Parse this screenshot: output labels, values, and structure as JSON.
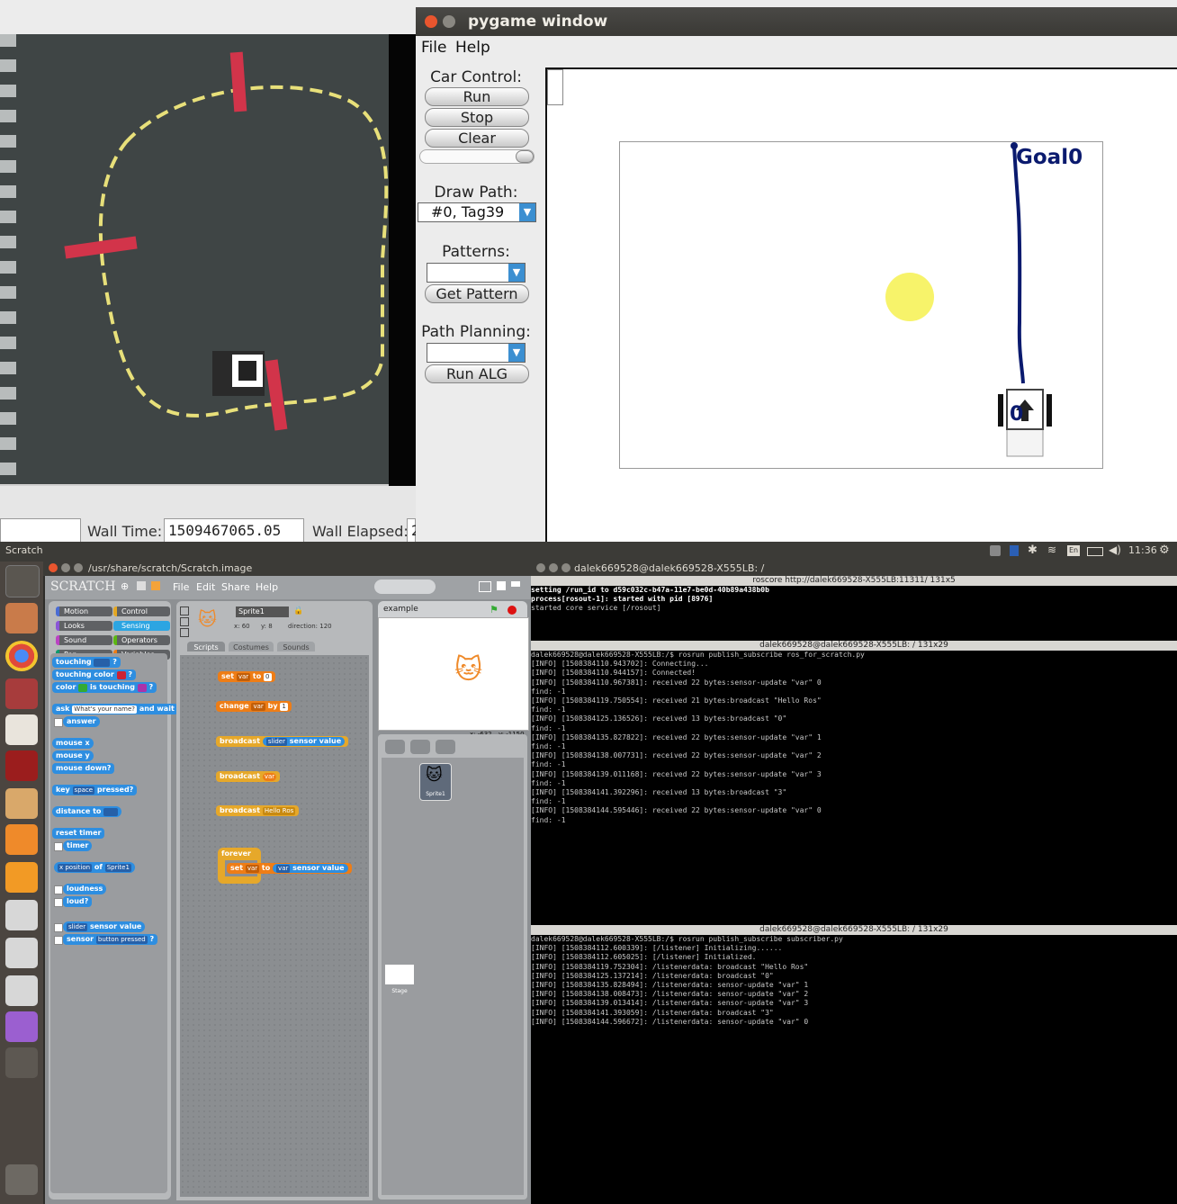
{
  "camera": {
    "status_left": "",
    "wall_time_label": "Wall Time:",
    "wall_time_value": "1509467065.05",
    "wall_elapsed_label": "Wall Elapsed:",
    "wall_elapsed_value": "2"
  },
  "pygame": {
    "title": "pygame window",
    "menu": [
      "File",
      "Help"
    ],
    "car_control_label": "Car Control:",
    "buttons": {
      "run": "Run",
      "stop": "Stop",
      "clear": "Clear",
      "get_pattern": "Get Pattern",
      "run_alg": "Run ALG"
    },
    "draw_path_label": "Draw Path:",
    "draw_path_value": "#0, Tag39",
    "patterns_label": "Patterns:",
    "patterns_value": "",
    "path_planning_label": "Path Planning:",
    "path_planning_value": "",
    "goal_label": "Goal0",
    "car_label": "0",
    "colors": {
      "path": "#0a1a6e",
      "goal": "#0a1a6e",
      "sun": "#f7f36a"
    }
  },
  "panel": {
    "title": "Scratch",
    "time": "11:36",
    "lang": "En"
  },
  "scratch": {
    "window_title": "/usr/share/scratch/Scratch.image",
    "logo": "SCRATCH",
    "menu": [
      "File",
      "Edit",
      "Share",
      "Help"
    ],
    "categories": [
      {
        "label": "Motion",
        "color": "#4a6cd4"
      },
      {
        "label": "Control",
        "color": "#e6a822"
      },
      {
        "label": "Looks",
        "color": "#8a55d7"
      },
      {
        "label": "Sensing",
        "color": "#2ca5e2"
      },
      {
        "label": "Sound",
        "color": "#bb42c3"
      },
      {
        "label": "Operators",
        "color": "#5cb712"
      },
      {
        "label": "Pen",
        "color": "#0e9a6c"
      },
      {
        "label": "Variables",
        "color": "#ee7d16"
      }
    ],
    "blocks": {
      "touching": "touching",
      "touching_color": "touching color",
      "color": "color",
      "is_touching": "is touching",
      "ask": "ask",
      "ask_text": "What's your name?",
      "and_wait": "and wait",
      "answer": "answer",
      "mouse_x": "mouse x",
      "mouse_y": "mouse y",
      "mouse_down": "mouse down?",
      "key": "key",
      "space": "space",
      "pressed": "pressed?",
      "distance_to": "distance to",
      "reset_timer": "reset timer",
      "timer": "timer",
      "x_position": "x position",
      "of": "of",
      "sprite1": "Sprite1",
      "loudness": "loudness",
      "loud": "loud?",
      "slider": "slider",
      "sensor_value": "sensor value",
      "sensor": "sensor",
      "button_pressed": "button pressed"
    },
    "sprite": {
      "name": "Sprite1",
      "x": "x: 60",
      "y": "y: 8",
      "direction": "direction: 120"
    },
    "tabs": [
      "Scripts",
      "Costumes",
      "Sounds"
    ],
    "scripts": {
      "set": "set",
      "var": "var",
      "to": "to",
      "zero": "0",
      "change": "change",
      "by": "by",
      "one": "1",
      "broadcast": "broadcast",
      "slider": "slider",
      "sensor_value": "sensor value",
      "hello_ros": "Hello Ros",
      "forever": "forever"
    },
    "stage_title": "example",
    "coords": {
      "x": "x: -632",
      "y": "y: -1150"
    },
    "sprite_tile": "Sprite1",
    "stage_tile": "Stage"
  },
  "terminal": {
    "window_title": "dalek669528@dalek669528-X555LB: /",
    "pane1_title": "roscore http://dalek669528-X555LB:11311/ 131x5",
    "pane1_lines": [
      "setting /run_id to d59c032c-b47a-11e7-be0d-40b89a438b0b",
      "process[rosout-1]: started with pid [8976]",
      "started core service [/rosout]"
    ],
    "pane2_title": "dalek669528@dalek669528-X555LB: / 131x29",
    "pane2_lines": [
      "dalek669528@dalek669528-X555LB:/$ rosrun publish_subscribe ros_for_scratch.py",
      "[INFO] [1508384110.943702]: Connecting...",
      "[INFO] [1508384110.944157]: Connected!",
      "[INFO] [1508384110.967381]: received 22 bytes:sensor-update \"var\" 0",
      "find: -1",
      "[INFO] [1508384119.750554]: received 21 bytes:broadcast \"Hello Ros\"",
      "find: -1",
      "[INFO] [1508384125.136526]: received 13 bytes:broadcast \"0\"",
      "find: -1",
      "[INFO] [1508384135.827822]: received 22 bytes:sensor-update \"var\" 1",
      "find: -1",
      "[INFO] [1508384138.007731]: received 22 bytes:sensor-update \"var\" 2",
      "find: -1",
      "[INFO] [1508384139.011168]: received 22 bytes:sensor-update \"var\" 3",
      "find: -1",
      "[INFO] [1508384141.392296]: received 13 bytes:broadcast \"3\"",
      "find: -1",
      "[INFO] [1508384144.595446]: received 22 bytes:sensor-update \"var\" 0",
      "find: -1"
    ],
    "pane3_title": "dalek669528@dalek669528-X555LB: / 131x29",
    "pane3_lines": [
      "dalek669528@dalek669528-X555LB:/$ rosrun publish_subscribe subscriber.py",
      "[INFO] [1508384112.600339]: [/listener] Initializing......",
      "[INFO] [1508384112.605025]: [/listener] Initialized.",
      "[INFO] [1508384119.752304]: /listenerdata: broadcast \"Hello Ros\"",
      "[INFO] [1508384125.137214]: /listenerdata: broadcast \"0\"",
      "[INFO] [1508384135.828494]: /listenerdata: sensor-update \"var\" 1",
      "[INFO] [1508384138.008473]: /listenerdata: sensor-update \"var\" 2",
      "[INFO] [1508384139.013414]: /listenerdata: sensor-update \"var\" 3",
      "[INFO] [1508384141.393059]: /listenerdata: broadcast \"3\"",
      "[INFO] [1508384144.596672]: /listenerdata: sensor-update \"var\" 0"
    ]
  }
}
